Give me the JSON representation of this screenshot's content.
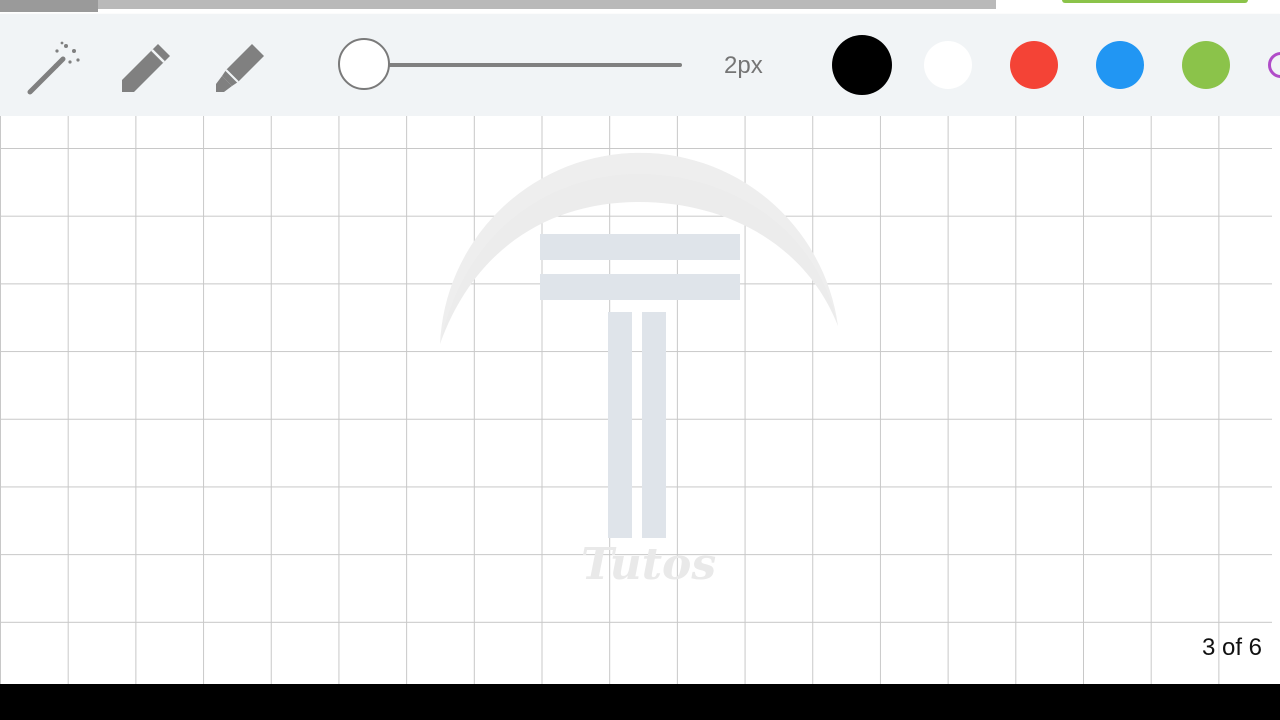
{
  "toolbar": {
    "tools": [
      {
        "name": "magic-wand-icon",
        "label": ""
      },
      {
        "name": "pencil-icon",
        "label": ""
      },
      {
        "name": "marker-icon",
        "label": ""
      }
    ],
    "stroke_size_label": "2px",
    "stroke_size_value": 2,
    "colors": [
      {
        "name": "black",
        "hex": "#000000"
      },
      {
        "name": "white",
        "hex": "#ffffff"
      },
      {
        "name": "red",
        "hex": "#f44336"
      },
      {
        "name": "blue",
        "hex": "#2196f3"
      },
      {
        "name": "green",
        "hex": "#8bc34a"
      },
      {
        "name": "purple",
        "hex": "#b04cc8"
      }
    ]
  },
  "canvas": {
    "watermark_text": "Tutos",
    "page_indicator": "3 of 6"
  },
  "theme": {
    "toolbar_bg": "#f1f4f6",
    "icon_color": "#808080",
    "grid_color": "#c8c8c8"
  }
}
